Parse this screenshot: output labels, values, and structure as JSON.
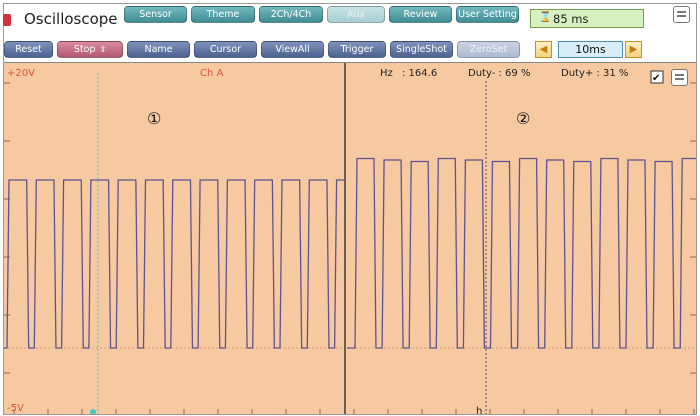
{
  "app": {
    "title": "Oscilloscope"
  },
  "top_buttons": [
    "Sensor",
    "Theme",
    "2Ch/4Ch",
    "Aux",
    "Review",
    "User Setting"
  ],
  "timer": {
    "value": "85 ms",
    "icon": "hourglass-icon"
  },
  "toolbar": {
    "reset": "Reset",
    "stop": "Stop",
    "stop_arrows": "⇕",
    "name": "Name",
    "cursor": "Cursor",
    "viewall": "ViewAll",
    "trigger": "Trigger",
    "singleshot": "SingleShot",
    "zeroset": "ZeroSet"
  },
  "timebase": {
    "value": "10ms",
    "prev": "◀",
    "next": "▶"
  },
  "scope": {
    "v_max": "+20V",
    "v_min": "-5V",
    "channel": "Ch A",
    "hz_label": "Hz",
    "hz_value": ": 164.6",
    "duty_minus": "Duty- : 69 %",
    "duty_plus": "Duty+ : 31 %",
    "marker_1": "①",
    "marker_2": "②",
    "cursor_h": "h",
    "check_mark": "✔"
  },
  "colors": {
    "screen": "#f6c9a0",
    "trace": "#5f5290",
    "label_red": "#e0523a",
    "cursor_cyan": "#44c9c4",
    "teal_button": "#4c9aa0",
    "blue_button": "#5a6e9d",
    "pink_button": "#c06a83"
  }
}
